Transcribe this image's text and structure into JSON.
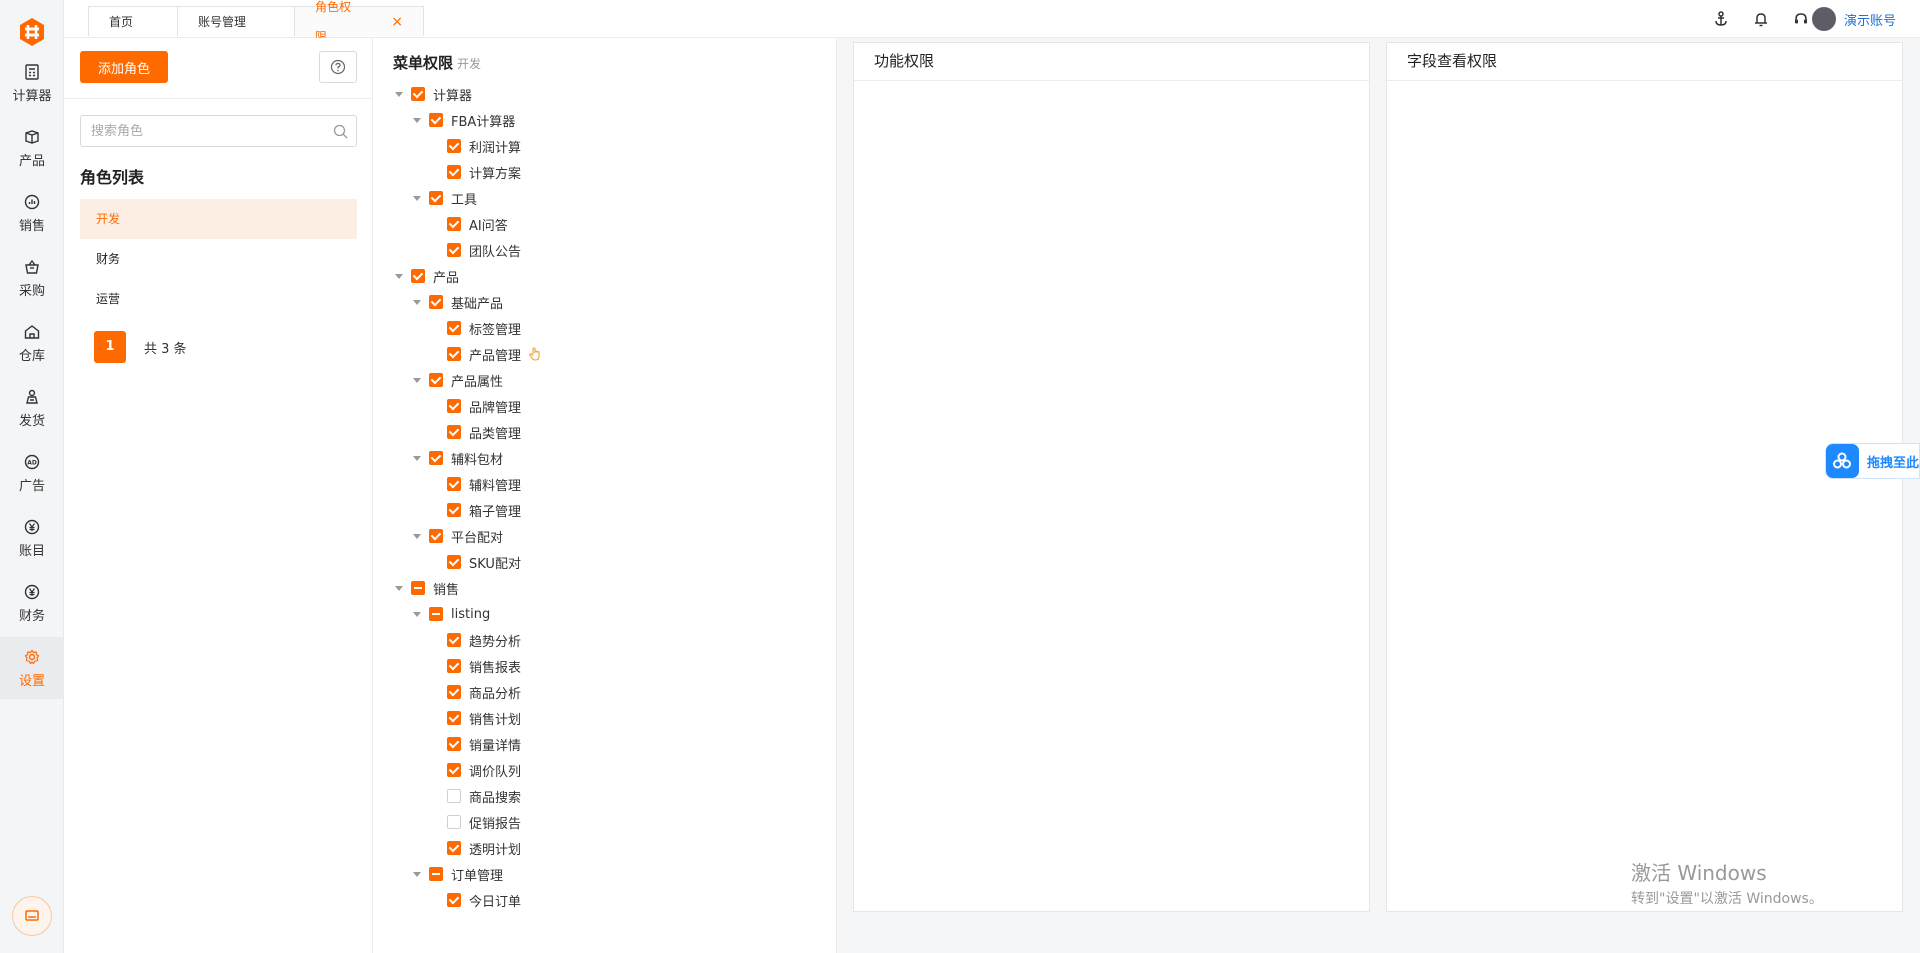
{
  "nav": {
    "items": [
      {
        "label": "计算器",
        "icon": "calculator-icon"
      },
      {
        "label": "产品",
        "icon": "box-icon"
      },
      {
        "label": "销售",
        "icon": "chart-icon"
      },
      {
        "label": "采购",
        "icon": "basket-icon"
      },
      {
        "label": "仓库",
        "icon": "warehouse-icon"
      },
      {
        "label": "发货",
        "icon": "shipping-icon"
      },
      {
        "label": "广告",
        "icon": "ad-icon"
      },
      {
        "label": "账目",
        "icon": "yen-icon"
      },
      {
        "label": "财务",
        "icon": "finance-icon"
      },
      {
        "label": "设置",
        "icon": "gear-icon"
      }
    ],
    "active_label": "设置"
  },
  "tabs": [
    {
      "label": "首页"
    },
    {
      "label": "账号管理"
    },
    {
      "label": "角色权限",
      "active": true,
      "close": "×"
    }
  ],
  "account": {
    "name": "演示账号"
  },
  "roles": {
    "add_label": "添加角色",
    "search_placeholder": "搜索角色",
    "title": "角色列表",
    "items": [
      "开发",
      "财务",
      "运营"
    ],
    "active": "开发",
    "page": "1",
    "total": "共 3 条"
  },
  "menu": {
    "title": "菜单权限",
    "subtitle": "开发",
    "tree": [
      {
        "label": "计算器",
        "level": 0,
        "state": "checked",
        "arrow": true
      },
      {
        "label": "FBA计算器",
        "level": 1,
        "state": "checked",
        "arrow": true
      },
      {
        "label": "利润计算",
        "level": 2,
        "state": "checked"
      },
      {
        "label": "计算方案",
        "level": 2,
        "state": "checked"
      },
      {
        "label": "工具",
        "level": 1,
        "state": "checked",
        "arrow": true
      },
      {
        "label": "AI问答",
        "level": 2,
        "state": "checked"
      },
      {
        "label": "团队公告",
        "level": 2,
        "state": "checked"
      },
      {
        "label": "产品",
        "level": 0,
        "state": "checked",
        "arrow": true
      },
      {
        "label": "基础产品",
        "level": 1,
        "state": "checked",
        "arrow": true
      },
      {
        "label": "标签管理",
        "level": 2,
        "state": "checked"
      },
      {
        "label": "产品管理",
        "level": 2,
        "state": "checked",
        "cursor": true
      },
      {
        "label": "产品属性",
        "level": 1,
        "state": "checked",
        "arrow": true
      },
      {
        "label": "品牌管理",
        "level": 2,
        "state": "checked"
      },
      {
        "label": "品类管理",
        "level": 2,
        "state": "checked"
      },
      {
        "label": "辅料包材",
        "level": 1,
        "state": "checked",
        "arrow": true
      },
      {
        "label": "辅料管理",
        "level": 2,
        "state": "checked"
      },
      {
        "label": "箱子管理",
        "level": 2,
        "state": "checked"
      },
      {
        "label": "平台配对",
        "level": 1,
        "state": "checked",
        "arrow": true
      },
      {
        "label": "SKU配对",
        "level": 2,
        "state": "checked"
      },
      {
        "label": "销售",
        "level": 0,
        "state": "partial",
        "arrow": true
      },
      {
        "label": "listing",
        "level": 1,
        "state": "partial",
        "arrow": true
      },
      {
        "label": "趋势分析",
        "level": 2,
        "state": "checked"
      },
      {
        "label": "销售报表",
        "level": 2,
        "state": "checked"
      },
      {
        "label": "商品分析",
        "level": 2,
        "state": "checked"
      },
      {
        "label": "销售计划",
        "level": 2,
        "state": "checked"
      },
      {
        "label": "销量详情",
        "level": 2,
        "state": "checked"
      },
      {
        "label": "调价队列",
        "level": 2,
        "state": "checked"
      },
      {
        "label": "商品搜索",
        "level": 2,
        "state": "unchecked"
      },
      {
        "label": "促销报告",
        "level": 2,
        "state": "unchecked"
      },
      {
        "label": "透明计划",
        "level": 2,
        "state": "checked"
      },
      {
        "label": "订单管理",
        "level": 1,
        "state": "partial",
        "arrow": true
      },
      {
        "label": "今日订单",
        "level": 2,
        "state": "checked"
      }
    ]
  },
  "panels": {
    "function_title": "功能权限",
    "field_title": "字段查看权限"
  },
  "drag": {
    "label": "拖拽至此"
  },
  "watermark": {
    "line1": "激活 Windows",
    "line2": "转到\"设置\"以激活 Windows。"
  },
  "colors": {
    "accent": "#ff6a00",
    "link": "#1f6fd6"
  }
}
